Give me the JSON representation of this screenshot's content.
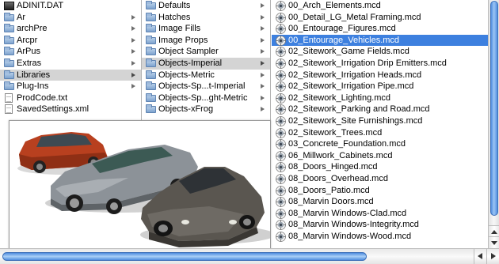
{
  "columns": {
    "col1": {
      "items": [
        {
          "label": "ADINIT.DAT",
          "icon": "dark-file-icon",
          "kind": "file",
          "selected": false
        },
        {
          "label": "Ar",
          "icon": "folder-icon",
          "kind": "folder",
          "selected": false
        },
        {
          "label": "archPre",
          "icon": "folder-icon",
          "kind": "folder",
          "selected": false
        },
        {
          "label": "Arcpr",
          "icon": "folder-icon",
          "kind": "folder",
          "selected": false
        },
        {
          "label": "ArPus",
          "icon": "folder-icon",
          "kind": "folder",
          "selected": false
        },
        {
          "label": "Extras",
          "icon": "folder-icon",
          "kind": "folder",
          "selected": false
        },
        {
          "label": "Libraries",
          "icon": "folder-icon",
          "kind": "folder",
          "selected": true
        },
        {
          "label": "Plug-Ins",
          "icon": "folder-icon",
          "kind": "folder",
          "selected": false
        },
        {
          "label": "ProdCode.txt",
          "icon": "document-icon",
          "kind": "file",
          "selected": false
        },
        {
          "label": "SavedSettings.xml",
          "icon": "document-icon",
          "kind": "file",
          "selected": false
        }
      ]
    },
    "col2": {
      "items": [
        {
          "label": "Defaults",
          "icon": "folder-icon",
          "selected": false
        },
        {
          "label": "Hatches",
          "icon": "folder-icon",
          "selected": false
        },
        {
          "label": "Image Fills",
          "icon": "folder-icon",
          "selected": false
        },
        {
          "label": "Image Props",
          "icon": "folder-icon",
          "selected": false
        },
        {
          "label": "Object Sampler",
          "icon": "folder-icon",
          "selected": false
        },
        {
          "label": "Objects-Imperial",
          "icon": "folder-icon",
          "selected": true
        },
        {
          "label": "Objects-Metric",
          "icon": "folder-icon",
          "selected": false
        },
        {
          "label": "Objects-Sp...t-Imperial",
          "icon": "folder-icon",
          "selected": false
        },
        {
          "label": "Objects-Sp...ght-Metric",
          "icon": "folder-icon",
          "selected": false
        },
        {
          "label": "Objects-xFrog",
          "icon": "folder-icon",
          "selected": false
        }
      ]
    },
    "col3": {
      "items": [
        {
          "label": "00_Arch_Elements.mcd",
          "selected": false
        },
        {
          "label": "00_Detail_LG_Metal Framing.mcd",
          "selected": false
        },
        {
          "label": "00_Entourage_Figures.mcd",
          "selected": false
        },
        {
          "label": "00_Entourage_Vehicles.mcd",
          "selected": true
        },
        {
          "label": "02_Sitework_Game Fields.mcd",
          "selected": false
        },
        {
          "label": "02_Sitework_Irrigation Drip Emitters.mcd",
          "selected": false
        },
        {
          "label": "02_Sitework_Irrigation Heads.mcd",
          "selected": false
        },
        {
          "label": "02_Sitework_Irrigation Pipe.mcd",
          "selected": false
        },
        {
          "label": "02_Sitework_Lighting.mcd",
          "selected": false
        },
        {
          "label": "02_Sitework_Parking and Road.mcd",
          "selected": false
        },
        {
          "label": "02_Sitework_Site Furnishings.mcd",
          "selected": false
        },
        {
          "label": "02_Sitework_Trees.mcd",
          "selected": false
        },
        {
          "label": "03_Concrete_Foundation.mcd",
          "selected": false
        },
        {
          "label": "06_Millwork_Cabinets.mcd",
          "selected": false
        },
        {
          "label": "08_Doors_Hinged.mcd",
          "selected": false
        },
        {
          "label": "08_Doors_Overhead.mcd",
          "selected": false
        },
        {
          "label": "08_Doors_Patio.mcd",
          "selected": false
        },
        {
          "label": "08_Marvin Doors.mcd",
          "selected": false
        },
        {
          "label": "08_Marvin Windows-Clad.mcd",
          "selected": false
        },
        {
          "label": "08_Marvin Windows-Integrity.mcd",
          "selected": false
        },
        {
          "label": "08_Marvin Windows-Wood.mcd",
          "selected": false
        }
      ]
    }
  },
  "preview": {
    "icon": "car-preview-image",
    "car_colors": {
      "red": "#b8401f",
      "silver": "#8c9298",
      "dark": "#5a5650"
    }
  },
  "colors": {
    "selection_blue": "#3d80df",
    "selection_grey": "#d4d4d4",
    "scrollbar_blue": "#4f8ddf"
  }
}
